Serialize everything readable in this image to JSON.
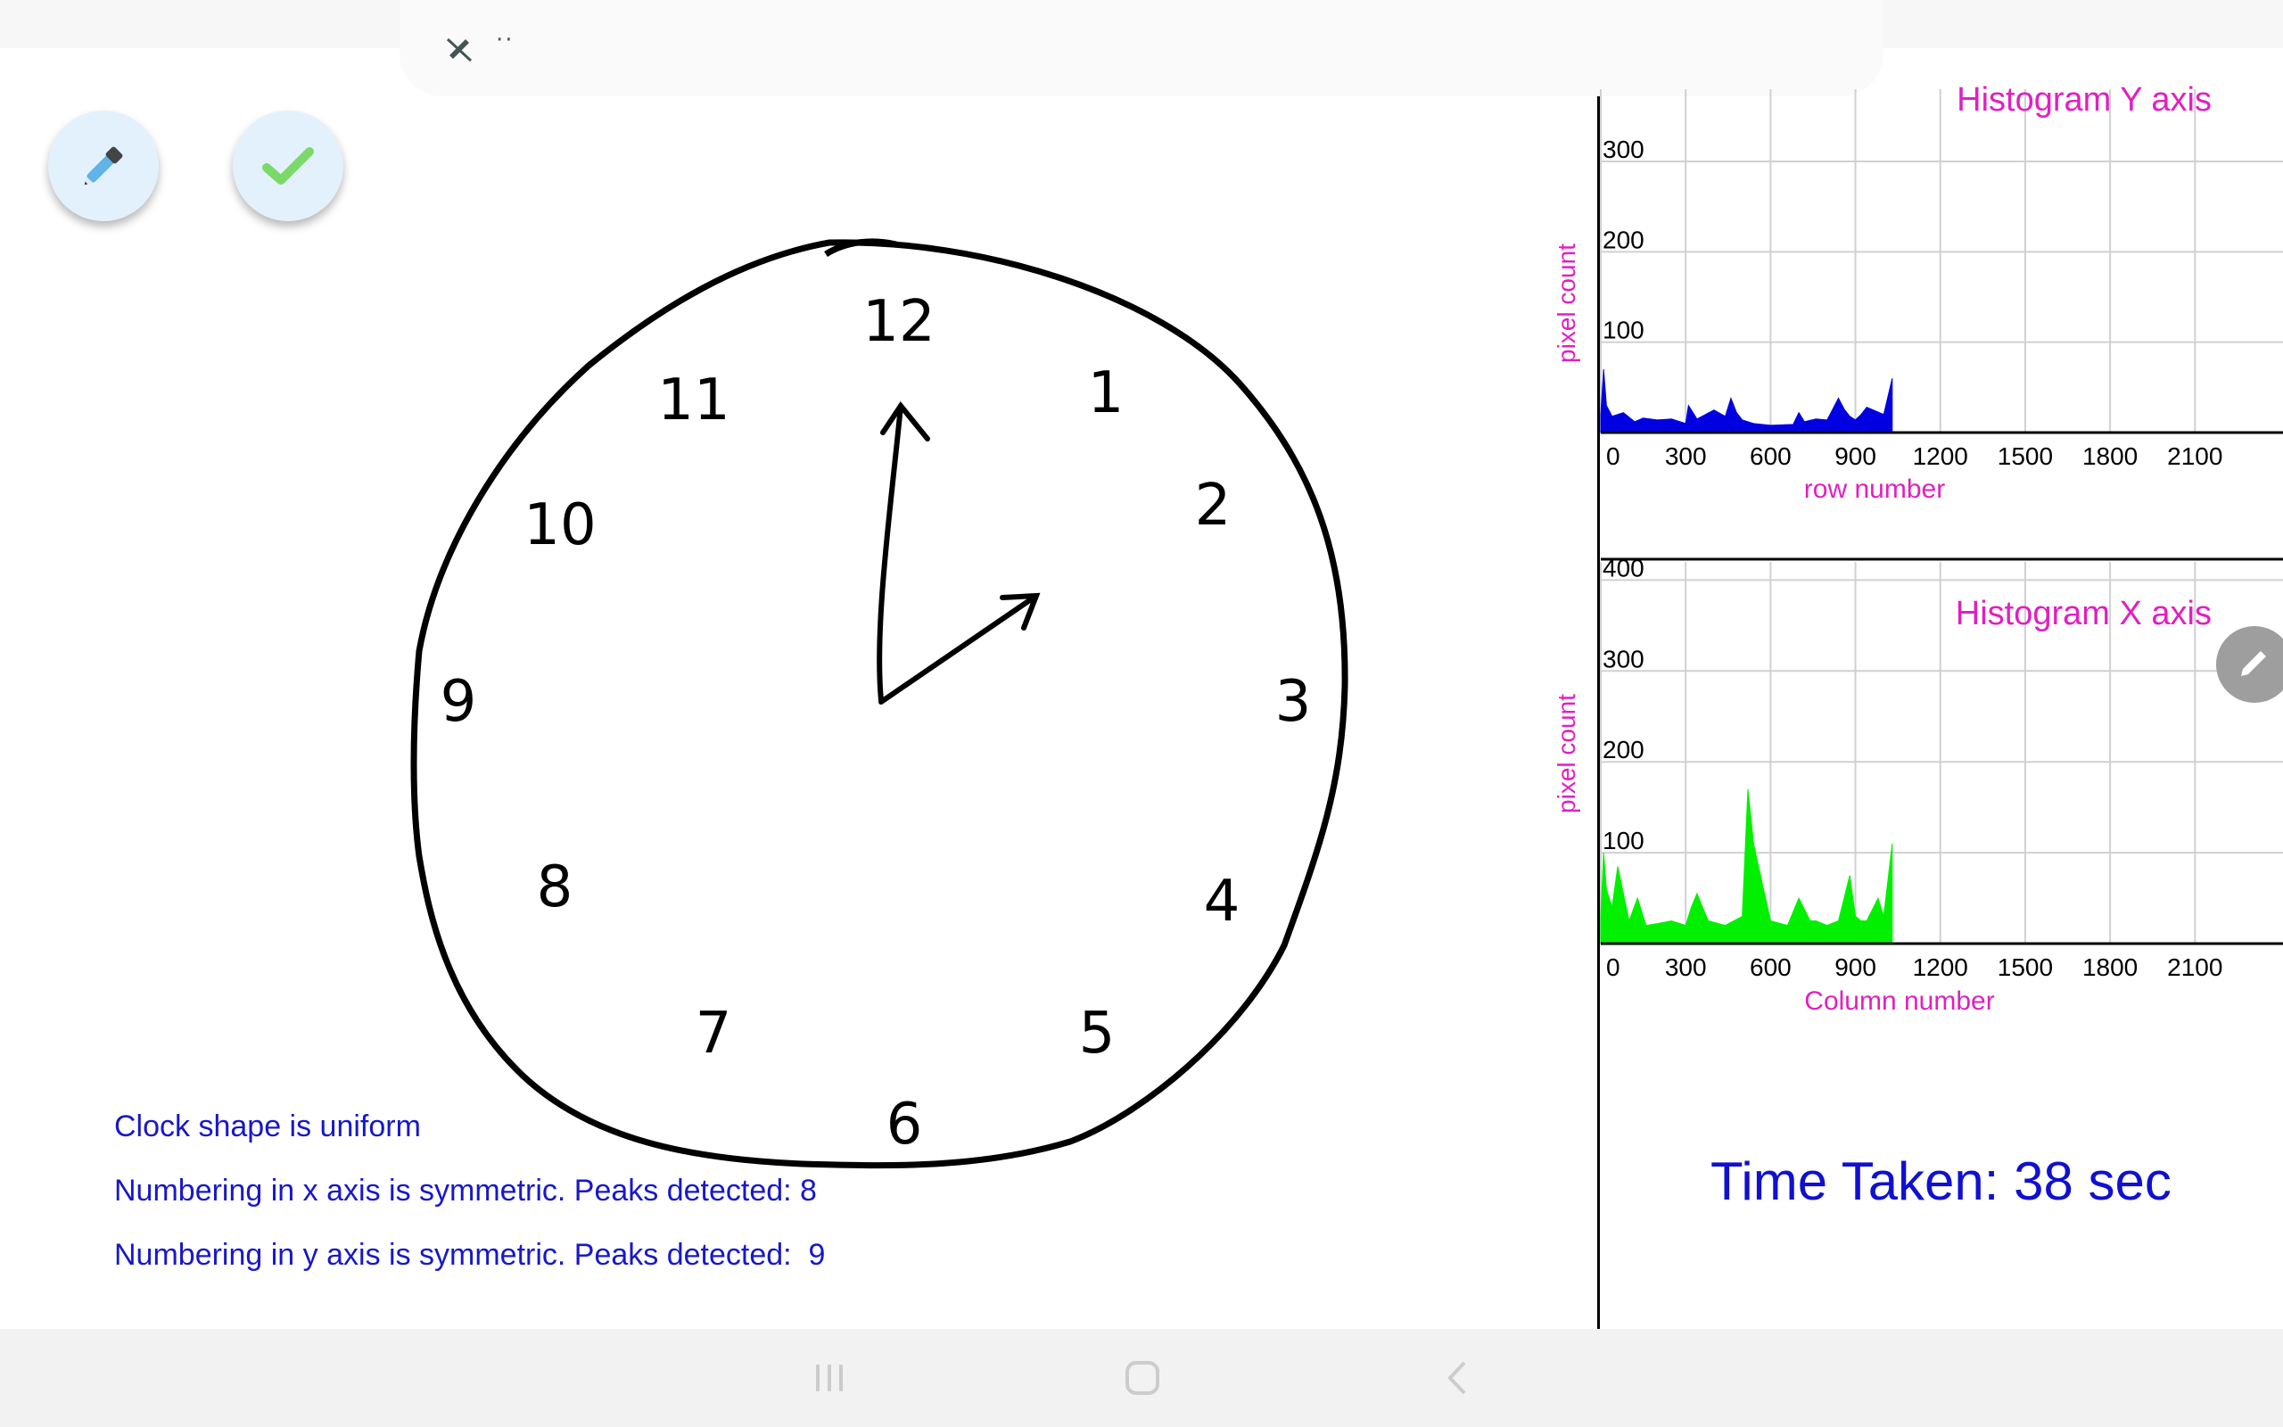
{
  "toolbar": {
    "dots": "··",
    "icon": "pen-off-icon"
  },
  "fabs": {
    "pen_icon": "pen-icon",
    "check_icon": "check-icon"
  },
  "clock": {
    "numbers": [
      "12",
      "1",
      "2",
      "3",
      "4",
      "5",
      "6",
      "7",
      "8",
      "9",
      "10",
      "11"
    ]
  },
  "messages": {
    "shape": "Clock shape is uniform",
    "x_axis": "Numbering in x axis is symmetric. Peaks detected: 8",
    "y_axis": "Numbering in y axis is symmetric. Peaks detected:  9"
  },
  "time_taken": "Time Taken: 38 sec",
  "colors": {
    "accent_text": "#1818c8",
    "chart_title": "#e020c0",
    "hist_y": "#0000e0",
    "hist_x": "#00f000"
  },
  "chart_data": [
    {
      "type": "area",
      "title": "Histogram Y axis",
      "xlabel": "row number",
      "ylabel": "pixel count",
      "x_ticks": [
        "0",
        "300",
        "600",
        "900",
        "1200",
        "1500",
        "1800",
        "2100"
      ],
      "y_ticks": [
        "100",
        "200",
        "300"
      ],
      "xlim": [
        0,
        2200
      ],
      "ylim": [
        0,
        380
      ],
      "grid": true,
      "color": "#0000e0",
      "x": [
        0,
        10,
        20,
        40,
        80,
        120,
        150,
        200,
        250,
        300,
        310,
        340,
        400,
        440,
        460,
        480,
        500,
        540,
        600,
        680,
        700,
        720,
        760,
        800,
        840,
        860,
        880,
        900,
        920,
        940,
        1000,
        1030
      ],
      "values": [
        20,
        70,
        30,
        18,
        22,
        12,
        16,
        14,
        15,
        10,
        30,
        15,
        25,
        18,
        38,
        22,
        14,
        10,
        8,
        9,
        22,
        12,
        15,
        14,
        38,
        26,
        18,
        14,
        20,
        28,
        20,
        60
      ]
    },
    {
      "type": "area",
      "title": "Histogram X axis",
      "xlabel": "Column number",
      "ylabel": "pixel count",
      "x_ticks": [
        "0",
        "300",
        "600",
        "900",
        "1200",
        "1500",
        "1800",
        "2100"
      ],
      "y_ticks": [
        "0",
        "100",
        "200",
        "300",
        "400"
      ],
      "xlim": [
        0,
        2200
      ],
      "ylim": [
        0,
        420
      ],
      "grid": true,
      "color": "#00f000",
      "x": [
        0,
        10,
        20,
        40,
        60,
        100,
        130,
        150,
        160,
        200,
        250,
        300,
        320,
        340,
        380,
        440,
        500,
        520,
        540,
        600,
        660,
        700,
        740,
        760,
        800,
        840,
        880,
        900,
        920,
        940,
        980,
        1000,
        1030
      ],
      "values": [
        30,
        100,
        60,
        40,
        85,
        25,
        50,
        30,
        20,
        22,
        25,
        20,
        40,
        55,
        25,
        20,
        30,
        170,
        110,
        25,
        20,
        50,
        25,
        25,
        20,
        25,
        75,
        30,
        25,
        25,
        50,
        30,
        110
      ]
    }
  ]
}
